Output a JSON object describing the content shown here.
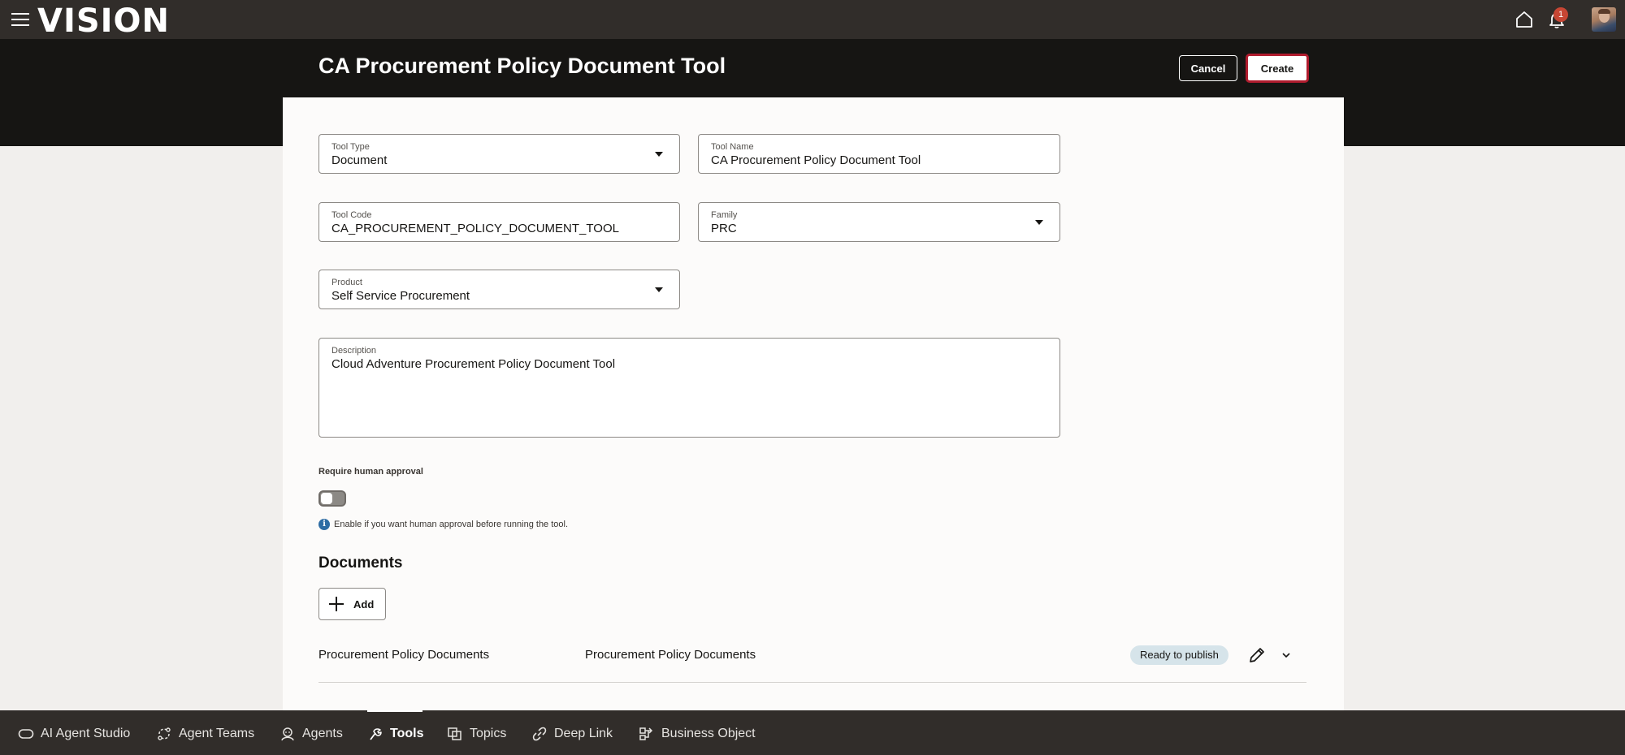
{
  "app": {
    "logo_text": "VISION",
    "notification_count": "1"
  },
  "header": {
    "title": "CA Procurement Policy Document Tool",
    "cancel_label": "Cancel",
    "create_label": "Create"
  },
  "form": {
    "tool_type": {
      "label": "Tool Type",
      "value": "Document"
    },
    "tool_name": {
      "label": "Tool Name",
      "value": "CA Procurement Policy Document Tool"
    },
    "tool_code": {
      "label": "Tool Code",
      "value": "CA_PROCUREMENT_POLICY_DOCUMENT_TOOL"
    },
    "family": {
      "label": "Family",
      "value": "PRC"
    },
    "product": {
      "label": "Product",
      "value": "Self Service Procurement"
    },
    "description": {
      "label": "Description",
      "value": "Cloud Adventure Procurement Policy Document Tool"
    },
    "require_approval": {
      "label": "Require human approval",
      "enabled": false,
      "helper": "Enable if you want human approval before running the tool."
    }
  },
  "documents": {
    "title": "Documents",
    "add_label": "Add",
    "rows": [
      {
        "name": "Procurement Policy Documents",
        "description": "Procurement Policy Documents",
        "status": "Ready to publish"
      }
    ]
  },
  "bottom_nav": {
    "active": "Tools",
    "items": [
      {
        "label": "AI Agent Studio",
        "icon": "studio-icon"
      },
      {
        "label": "Agent Teams",
        "icon": "agent-teams-icon"
      },
      {
        "label": "Agents",
        "icon": "agents-icon"
      },
      {
        "label": "Tools",
        "icon": "tools-icon"
      },
      {
        "label": "Topics",
        "icon": "topics-icon"
      },
      {
        "label": "Deep Link",
        "icon": "link-icon"
      },
      {
        "label": "Business Object",
        "icon": "business-object-icon"
      }
    ]
  },
  "colors": {
    "topbar": "#312d2a",
    "header_band": "#161513",
    "create_border": "#b01c2e",
    "badge_bg": "#d6e4ea",
    "info": "#2e6da4"
  }
}
